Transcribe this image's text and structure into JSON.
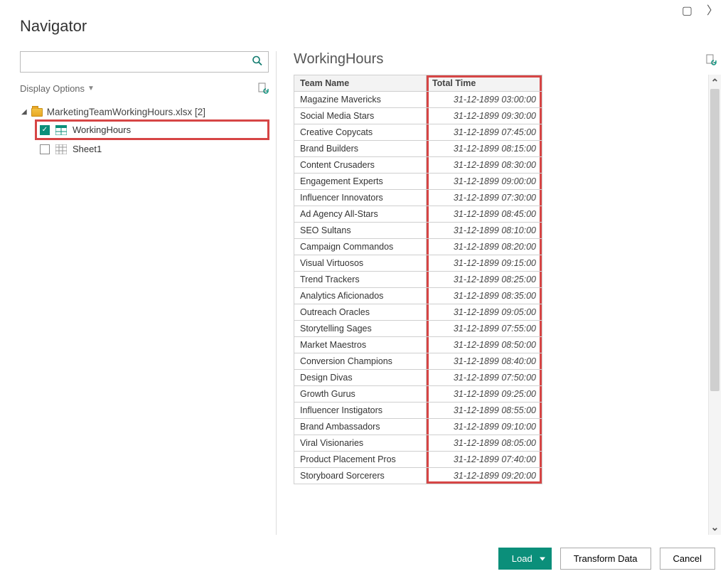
{
  "window": {
    "title": "Navigator"
  },
  "search": {
    "value": "",
    "placeholder": ""
  },
  "display_options": {
    "label": "Display Options"
  },
  "tree": {
    "file_label": "MarketingTeamWorkingHours.xlsx [2]",
    "items": [
      {
        "label": "WorkingHours",
        "checked": true,
        "icon": "table-green"
      },
      {
        "label": "Sheet1",
        "checked": false,
        "icon": "sheet"
      }
    ]
  },
  "preview": {
    "title": "WorkingHours",
    "columns": [
      "Team Name",
      "Total Time"
    ],
    "rows": [
      {
        "team": "Magazine Mavericks",
        "time": "31-12-1899 03:00:00"
      },
      {
        "team": "Social Media Stars",
        "time": "31-12-1899 09:30:00"
      },
      {
        "team": "Creative Copycats",
        "time": "31-12-1899 07:45:00"
      },
      {
        "team": "Brand Builders",
        "time": "31-12-1899 08:15:00"
      },
      {
        "team": "Content Crusaders",
        "time": "31-12-1899 08:30:00"
      },
      {
        "team": "Engagement Experts",
        "time": "31-12-1899 09:00:00"
      },
      {
        "team": "Influencer Innovators",
        "time": "31-12-1899 07:30:00"
      },
      {
        "team": "Ad Agency All-Stars",
        "time": "31-12-1899 08:45:00"
      },
      {
        "team": "SEO Sultans",
        "time": "31-12-1899 08:10:00"
      },
      {
        "team": "Campaign Commandos",
        "time": "31-12-1899 08:20:00"
      },
      {
        "team": "Visual Virtuosos",
        "time": "31-12-1899 09:15:00"
      },
      {
        "team": "Trend Trackers",
        "time": "31-12-1899 08:25:00"
      },
      {
        "team": "Analytics Aficionados",
        "time": "31-12-1899 08:35:00"
      },
      {
        "team": "Outreach Oracles",
        "time": "31-12-1899 09:05:00"
      },
      {
        "team": "Storytelling Sages",
        "time": "31-12-1899 07:55:00"
      },
      {
        "team": "Market Maestros",
        "time": "31-12-1899 08:50:00"
      },
      {
        "team": "Conversion Champions",
        "time": "31-12-1899 08:40:00"
      },
      {
        "team": "Design Divas",
        "time": "31-12-1899 07:50:00"
      },
      {
        "team": "Growth Gurus",
        "time": "31-12-1899 09:25:00"
      },
      {
        "team": "Influencer Instigators",
        "time": "31-12-1899 08:55:00"
      },
      {
        "team": "Brand Ambassadors",
        "time": "31-12-1899 09:10:00"
      },
      {
        "team": "Viral Visionaries",
        "time": "31-12-1899 08:05:00"
      },
      {
        "team": "Product Placement Pros",
        "time": "31-12-1899 07:40:00"
      },
      {
        "team": "Storyboard Sorcerers",
        "time": "31-12-1899 09:20:00"
      }
    ]
  },
  "buttons": {
    "load": "Load",
    "transform": "Transform Data",
    "cancel": "Cancel"
  }
}
